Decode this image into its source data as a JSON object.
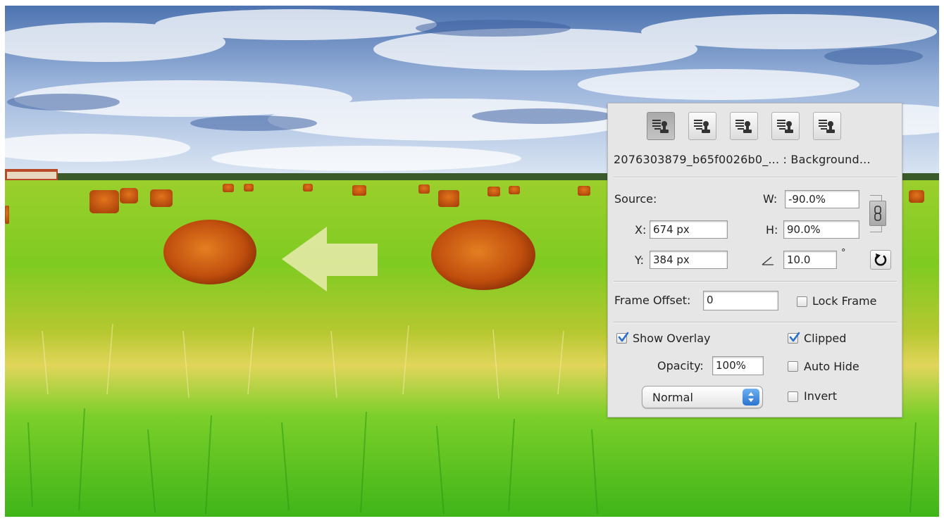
{
  "clone_source_panel": {
    "source_buttons": [
      {
        "icon": "clone-source-icon",
        "active": true
      },
      {
        "icon": "clone-source-icon",
        "active": false
      },
      {
        "icon": "clone-source-icon",
        "active": false
      },
      {
        "icon": "clone-source-icon",
        "active": false
      },
      {
        "icon": "clone-source-icon",
        "active": false
      }
    ],
    "source_name": "2076303879_b65f0026b0_... : Background...",
    "source_label": "Source:",
    "x_label": "X:",
    "x_value": "674 px",
    "y_label": "Y:",
    "y_value": "384 px",
    "w_label": "W:",
    "w_value": "-90.0%",
    "h_label": "H:",
    "h_value": "90.0%",
    "angle_value": "10.0",
    "degree_symbol": "°",
    "link_icon": "chain-link-icon",
    "reset_icon": "rotate-reset-icon",
    "frame_offset_label": "Frame Offset:",
    "frame_offset_value": "0",
    "lock_frame_label": "Lock Frame",
    "lock_frame_checked": false,
    "show_overlay_label": "Show Overlay",
    "show_overlay_checked": true,
    "clipped_label": "Clipped",
    "clipped_checked": true,
    "opacity_label": "Opacity:",
    "opacity_value": "100%",
    "auto_hide_label": "Auto Hide",
    "auto_hide_checked": false,
    "blend_mode": "Normal",
    "invert_label": "Invert",
    "invert_checked": false
  },
  "colors": {
    "sky": "#6f92c4",
    "grass": "#4fc11c",
    "hay": "#c75a10",
    "checkbox_check": "#2a6fc9",
    "select_accent": "#3b86de"
  }
}
